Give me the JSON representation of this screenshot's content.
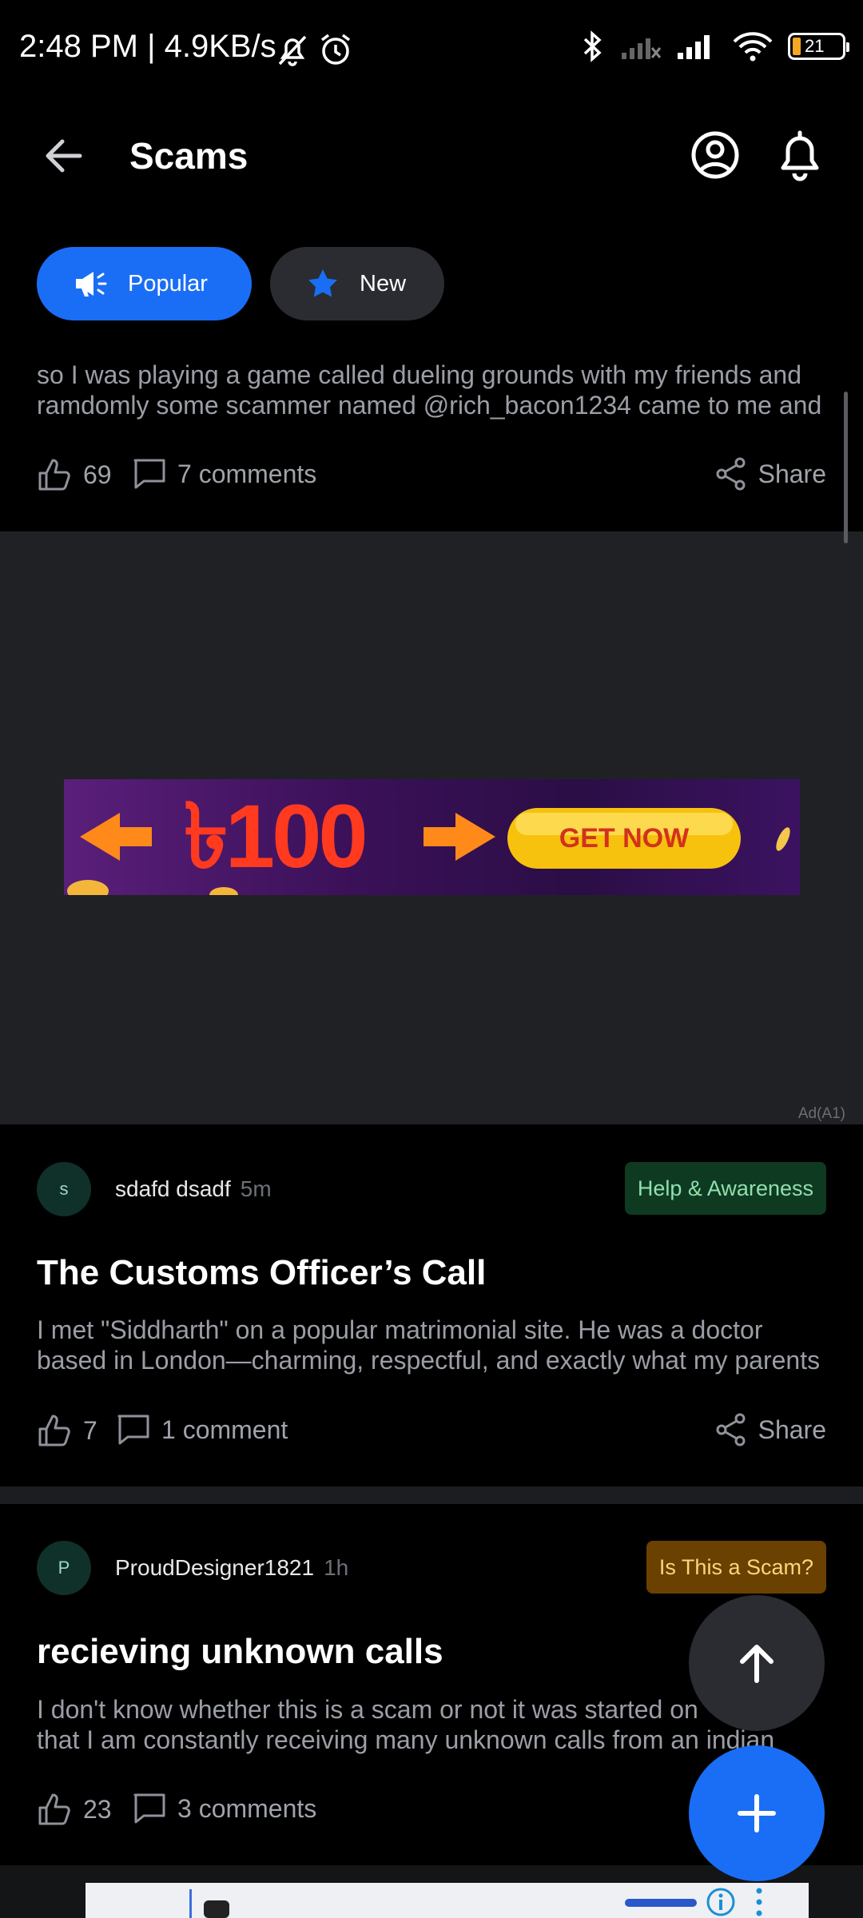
{
  "status_bar": {
    "time_speed": "2:48 PM | 4.9KB/s",
    "battery": "21"
  },
  "header": {
    "title": "Scams"
  },
  "tabs": [
    {
      "label": "Popular",
      "active": true
    },
    {
      "label": "New",
      "active": false
    }
  ],
  "posts": [
    {
      "excerpt_line1": "so I was playing a game called dueling grounds with my friends and",
      "excerpt_line2": "ramdomly some scammer named @rich_bacon1234 came to me and",
      "likes": "69",
      "comments": "7 comments",
      "share": "Share"
    },
    {
      "avatar": "s",
      "author": "sdafd dsadf",
      "time": "5m",
      "badge": "Help & Awareness",
      "title": "The Customs Officer’s Call",
      "excerpt_line1": "I met \"Siddharth\" on a popular matrimonial site. He was a doctor",
      "excerpt_line2": "based in London—charming, respectful, and exactly what my parents",
      "likes": "7",
      "comments": "1 comment",
      "share": "Share"
    },
    {
      "avatar": "P",
      "author": "ProudDesigner1821",
      "time": "1h",
      "badge": "Is This a Scam?",
      "title": "recieving unknown calls",
      "excerpt_line1": "I don't know whether this is a scam or not it was started on",
      "excerpt_line2": "that I am constantly receiving many unknown calls from an indian",
      "likes": "23",
      "comments": "3 comments"
    }
  ],
  "ad": {
    "amount": "৳100",
    "cta": "GET NOW",
    "label": "Ad(A1)"
  },
  "colors": {
    "accent": "#1a6ef5",
    "background": "#000000",
    "ad_background": "#202125"
  }
}
